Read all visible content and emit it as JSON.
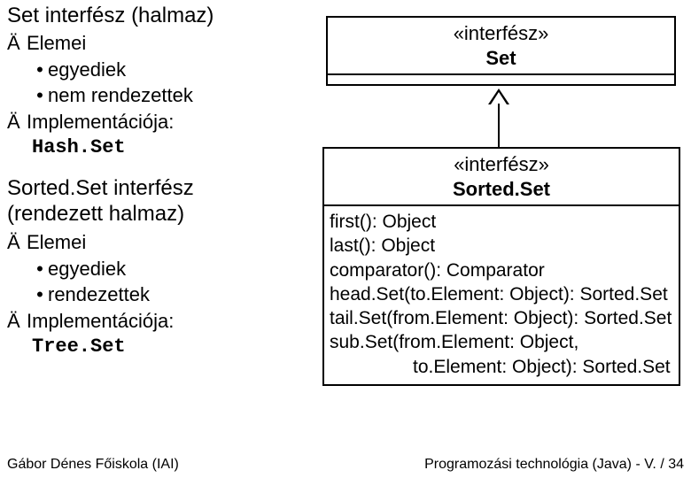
{
  "left": {
    "set_title": "Set interfész (halmaz)",
    "elemei": "Elemei",
    "egyediek": "egyediek",
    "nem_rendezettek": "nem rendezettek",
    "implementacioja": "Implementációja:",
    "hashset": "Hash.Set",
    "sortedset_title1": "Sorted.Set interfész",
    "sortedset_title2": "(rendezett halmaz)",
    "rendezettek": "rendezettek",
    "treeset": "Tree.Set"
  },
  "uml": {
    "stereotype": "«interfész»",
    "set_name": "Set",
    "sortedset_name": "Sorted.Set",
    "methods": {
      "m1": "first(): Object",
      "m2": "last(): Object",
      "m3": "comparator(): Comparator",
      "m4": "head.Set(to.Element: Object): Sorted.Set",
      "m5": "tail.Set(from.Element: Object): Sorted.Set",
      "m6a": "sub.Set(from.Element: Object,",
      "m6b": "to.Element: Object): Sorted.Set"
    }
  },
  "footer": {
    "left": "Gábor Dénes Főiskola (IAI)",
    "right": "Programozási technológia (Java)  -  V. / 34"
  },
  "bullets": {
    "arrow": "Ä",
    "dot": "•"
  }
}
